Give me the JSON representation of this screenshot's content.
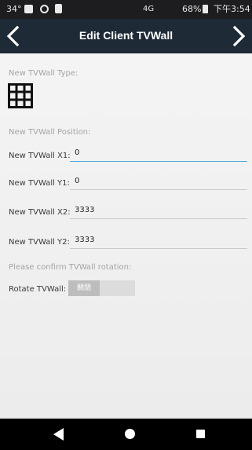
{
  "status_bar": {
    "temperature": "34°",
    "network": "4G",
    "battery": "68%",
    "time": "下午3:54"
  },
  "header": {
    "title": "Edit Client TVWall",
    "back_icon": "chevron-left-icon",
    "next_icon": "chevron-right-icon"
  },
  "form": {
    "type_label": "New TVWall Type:",
    "type_icon": "grid-3x3-icon",
    "position_label": "New TVWall Position:",
    "fields": [
      {
        "label": "New TVWall X1:",
        "value": "0"
      },
      {
        "label": "New TVWall Y1:",
        "value": "0"
      },
      {
        "label": "New TVWall X2:",
        "value": "3333"
      },
      {
        "label": "New TVWall Y2:",
        "value": "3333"
      }
    ],
    "confirm_label": "Please confirm TVWall rotation:",
    "rotate_label": "Rotate TVWall:",
    "rotate_toggle_text": "關閉"
  },
  "colors": {
    "header_bg": "#1e2a36",
    "focus_underline": "#4aa7d7"
  }
}
